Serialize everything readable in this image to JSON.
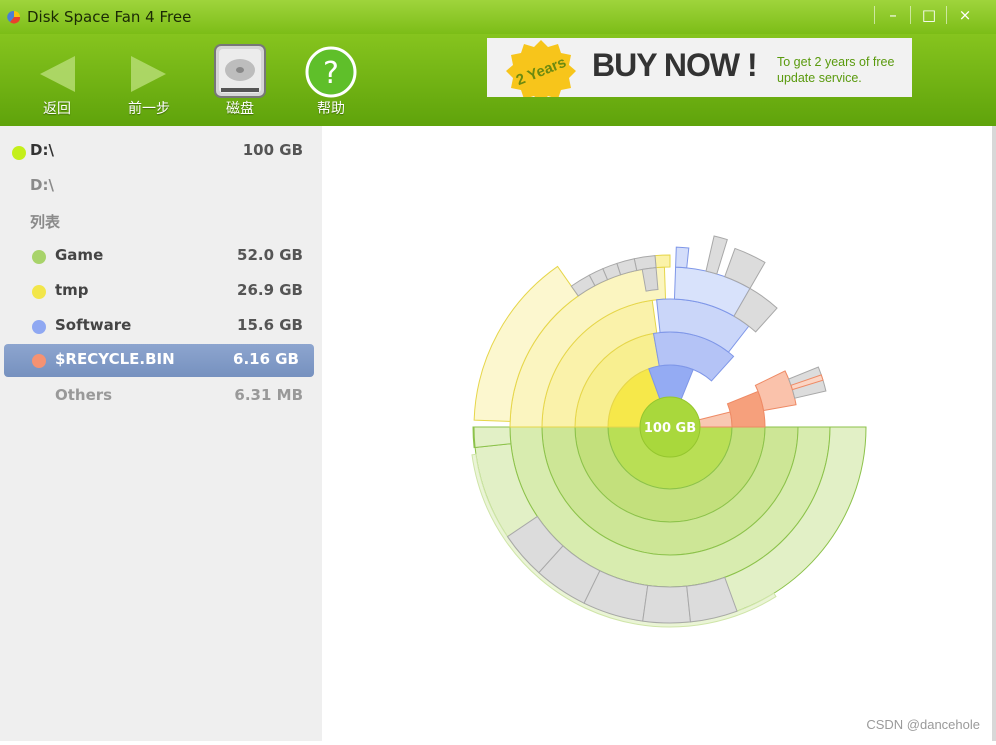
{
  "window": {
    "title": "Disk Space Fan 4 Free",
    "minimize": "–",
    "maximize": "□",
    "close": "×"
  },
  "toolbar": {
    "back": "返回",
    "forward": "前一步",
    "disk": "磁盘",
    "help": "帮助"
  },
  "ad": {
    "badge": "2 Years",
    "headline": "BUY NOW !",
    "subline": "To get  2  years of free update service."
  },
  "sidebar": {
    "drive": {
      "label": "D:\\",
      "size": "100 GB",
      "color": "#c4ef1a"
    },
    "path": "D:\\",
    "list_label": "列表",
    "items": [
      {
        "name": "Game",
        "size": "52.0 GB",
        "color": "#a8d36a"
      },
      {
        "name": "tmp",
        "size": "26.9 GB",
        "color": "#f2e64a"
      },
      {
        "name": "Software",
        "size": "15.6 GB",
        "color": "#8fa8f2"
      },
      {
        "name": "$RECYCLE.BIN",
        "size": "6.16 GB",
        "color": "#f59272"
      },
      {
        "name": "Others",
        "size": "6.31 MB",
        "color": ""
      }
    ]
  },
  "chart": {
    "center_label": "100 GB"
  },
  "watermark": "CSDN @dancehole"
}
